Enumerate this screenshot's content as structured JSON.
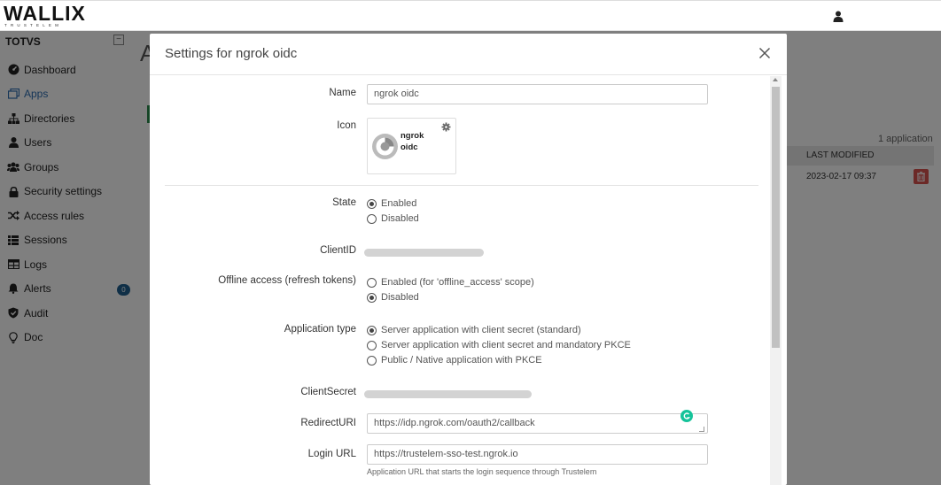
{
  "topbar": {
    "logo_main": "WALLIX",
    "logo_sub": "TRUSTELEM",
    "user_icon": "user-icon"
  },
  "sidebar": {
    "org_name": "TOTVS",
    "items": [
      {
        "label": "Dashboard",
        "icon": "dashboard-icon"
      },
      {
        "label": "Apps",
        "icon": "apps-icon",
        "active": true
      },
      {
        "label": "Directories",
        "icon": "directories-icon"
      },
      {
        "label": "Users",
        "icon": "user-icon"
      },
      {
        "label": "Groups",
        "icon": "groups-icon"
      },
      {
        "label": "Security settings",
        "icon": "lock-icon"
      },
      {
        "label": "Access rules",
        "icon": "shuffle-icon"
      },
      {
        "label": "Sessions",
        "icon": "list-icon"
      },
      {
        "label": "Logs",
        "icon": "table-icon"
      },
      {
        "label": "Alerts",
        "icon": "bell-icon",
        "badge": "0"
      },
      {
        "label": "Audit",
        "icon": "shield-icon"
      },
      {
        "label": "Doc",
        "icon": "lightbulb-icon"
      }
    ]
  },
  "page": {
    "title_initial": "A",
    "app_count": "1 application",
    "table_header": "LAST MODIFIED",
    "row_modified": "2023-02-17 09:37"
  },
  "modal": {
    "title": "Settings for ngrok oidc",
    "name_label": "Name",
    "name_value": "ngrok oidc",
    "icon_label": "Icon",
    "icon_text_line1": "ngrok",
    "icon_text_line2": "oidc",
    "state_label": "State",
    "state_options": [
      "Enabled",
      "Disabled"
    ],
    "client_id_label": "ClientID",
    "offline_label": "Offline access (refresh tokens)",
    "offline_options": [
      "Enabled (for 'offline_access' scope)",
      "Disabled"
    ],
    "app_type_label": "Application type",
    "app_type_options": [
      "Server application with client secret (standard)",
      "Server application with client secret and mandatory PKCE",
      "Public / Native application with PKCE"
    ],
    "client_secret_label": "ClientSecret",
    "redirect_label": "RedirectURI",
    "redirect_value": "https://idp.ngrok.com/oauth2/callback",
    "login_label": "Login URL",
    "login_value": "https://trustelem-sso-test.ngrok.io",
    "login_help": "Application URL that starts the login sequence through Trustelem"
  },
  "colors": {
    "accent": "#2c6db0",
    "badge": "#1f5e8e",
    "danger": "#d9534f",
    "grammarly": "#15c39a"
  }
}
